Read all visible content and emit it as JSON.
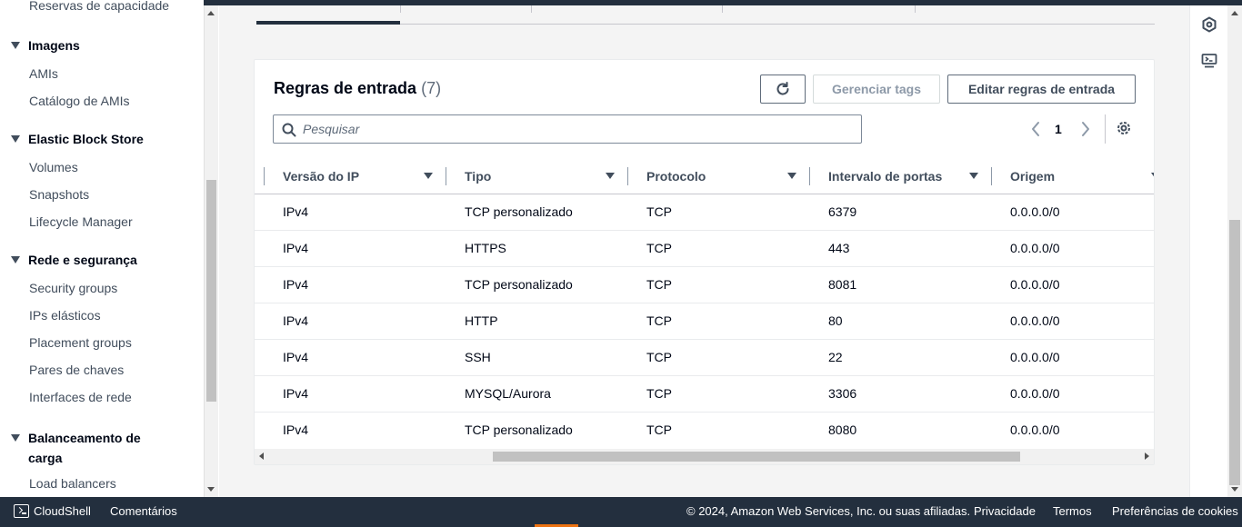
{
  "sidebar": {
    "truncated_top_item": "Reservas de capacidade",
    "sections": [
      {
        "title": "Imagens",
        "items": [
          "AMIs",
          "Catálogo de AMIs"
        ]
      },
      {
        "title": "Elastic Block Store",
        "items": [
          "Volumes",
          "Snapshots",
          "Lifecycle Manager"
        ]
      },
      {
        "title": "Rede e segurança",
        "items": [
          "Security groups",
          "IPs elásticos",
          "Placement groups",
          "Pares de chaves",
          "Interfaces de rede"
        ]
      },
      {
        "title": "Balanceamento de carga",
        "items": [
          "Load balancers"
        ]
      }
    ]
  },
  "panel": {
    "title": "Regras de entrada",
    "count": "(7)",
    "refresh_icon": "refresh-icon",
    "manage_tags_label": "Gerenciar tags",
    "edit_rules_label": "Editar regras de entrada",
    "search_placeholder": "Pesquisar",
    "search_value": "",
    "page_number": "1"
  },
  "table": {
    "columns": [
      "Versão do IP",
      "Tipo",
      "Protocolo",
      "Intervalo de portas",
      "Origem"
    ],
    "rows": [
      [
        "IPv4",
        "TCP personalizado",
        "TCP",
        "6379",
        "0.0.0.0/0"
      ],
      [
        "IPv4",
        "HTTPS",
        "TCP",
        "443",
        "0.0.0.0/0"
      ],
      [
        "IPv4",
        "TCP personalizado",
        "TCP",
        "8081",
        "0.0.0.0/0"
      ],
      [
        "IPv4",
        "HTTP",
        "TCP",
        "80",
        "0.0.0.0/0"
      ],
      [
        "IPv4",
        "SSH",
        "TCP",
        "22",
        "0.0.0.0/0"
      ],
      [
        "IPv4",
        "MYSQL/Aurora",
        "TCP",
        "3306",
        "0.0.0.0/0"
      ],
      [
        "IPv4",
        "TCP personalizado",
        "TCP",
        "8080",
        "0.0.0.0/0"
      ]
    ]
  },
  "footer": {
    "cloudshell": "CloudShell",
    "feedback": "Comentários",
    "copyright": "© 2024, Amazon Web Services, Inc. ou suas afiliadas.",
    "privacy": "Privacidade",
    "terms": "Termos",
    "cookies": "Preferências de cookies"
  },
  "colors": {
    "nav_dark": "#232f3e",
    "accent_orange": "#ec7211",
    "text": "#000716",
    "muted": "#5f6b7a"
  }
}
